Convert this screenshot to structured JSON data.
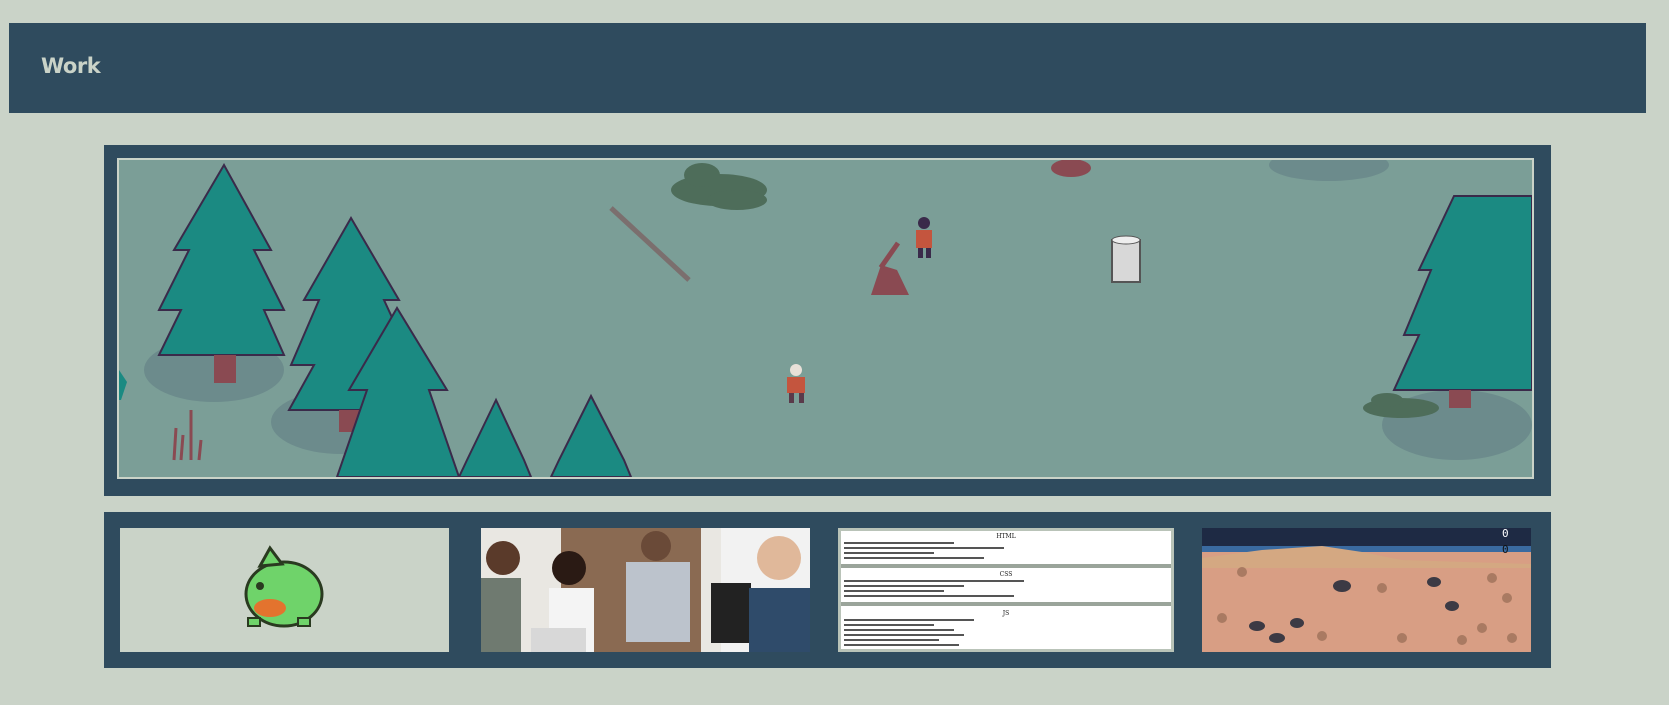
{
  "header": {
    "title": "Work"
  },
  "hero": {
    "name": "pixel forest game scene",
    "colors": {
      "grass": "#7b9e97",
      "tree": "#1b8a82",
      "shadow": "#6d8a88",
      "trunk": "#8a4a52"
    }
  },
  "thumbnails": [
    {
      "name": "pixel creature sprite",
      "bg": "#cad3c8"
    },
    {
      "name": "team meeting photo"
    },
    {
      "name": "web document page",
      "sections": [
        "HTML",
        "CSS",
        "JS"
      ]
    },
    {
      "name": "desert game scene",
      "score": [
        "0",
        "0"
      ]
    }
  ]
}
